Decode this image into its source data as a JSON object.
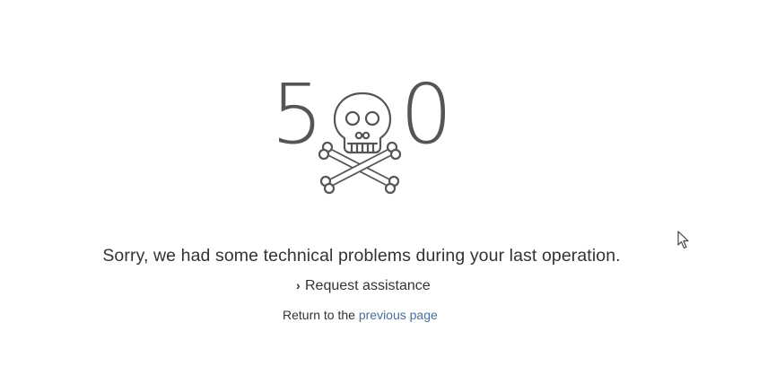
{
  "error": {
    "code_left_digit": "5",
    "code_right_digit": "0",
    "skull_icon": "skull-and-crossbones-icon"
  },
  "message": "Sorry, we had some technical problems during your last operation.",
  "assistance": {
    "chevron": "›",
    "label": "Request assistance"
  },
  "return_line": {
    "prefix": "Return to the ",
    "link_label": "previous page"
  },
  "colors": {
    "text": "#333333",
    "graphic": "#555555",
    "link": "#4a6f9a",
    "background": "#ffffff"
  }
}
